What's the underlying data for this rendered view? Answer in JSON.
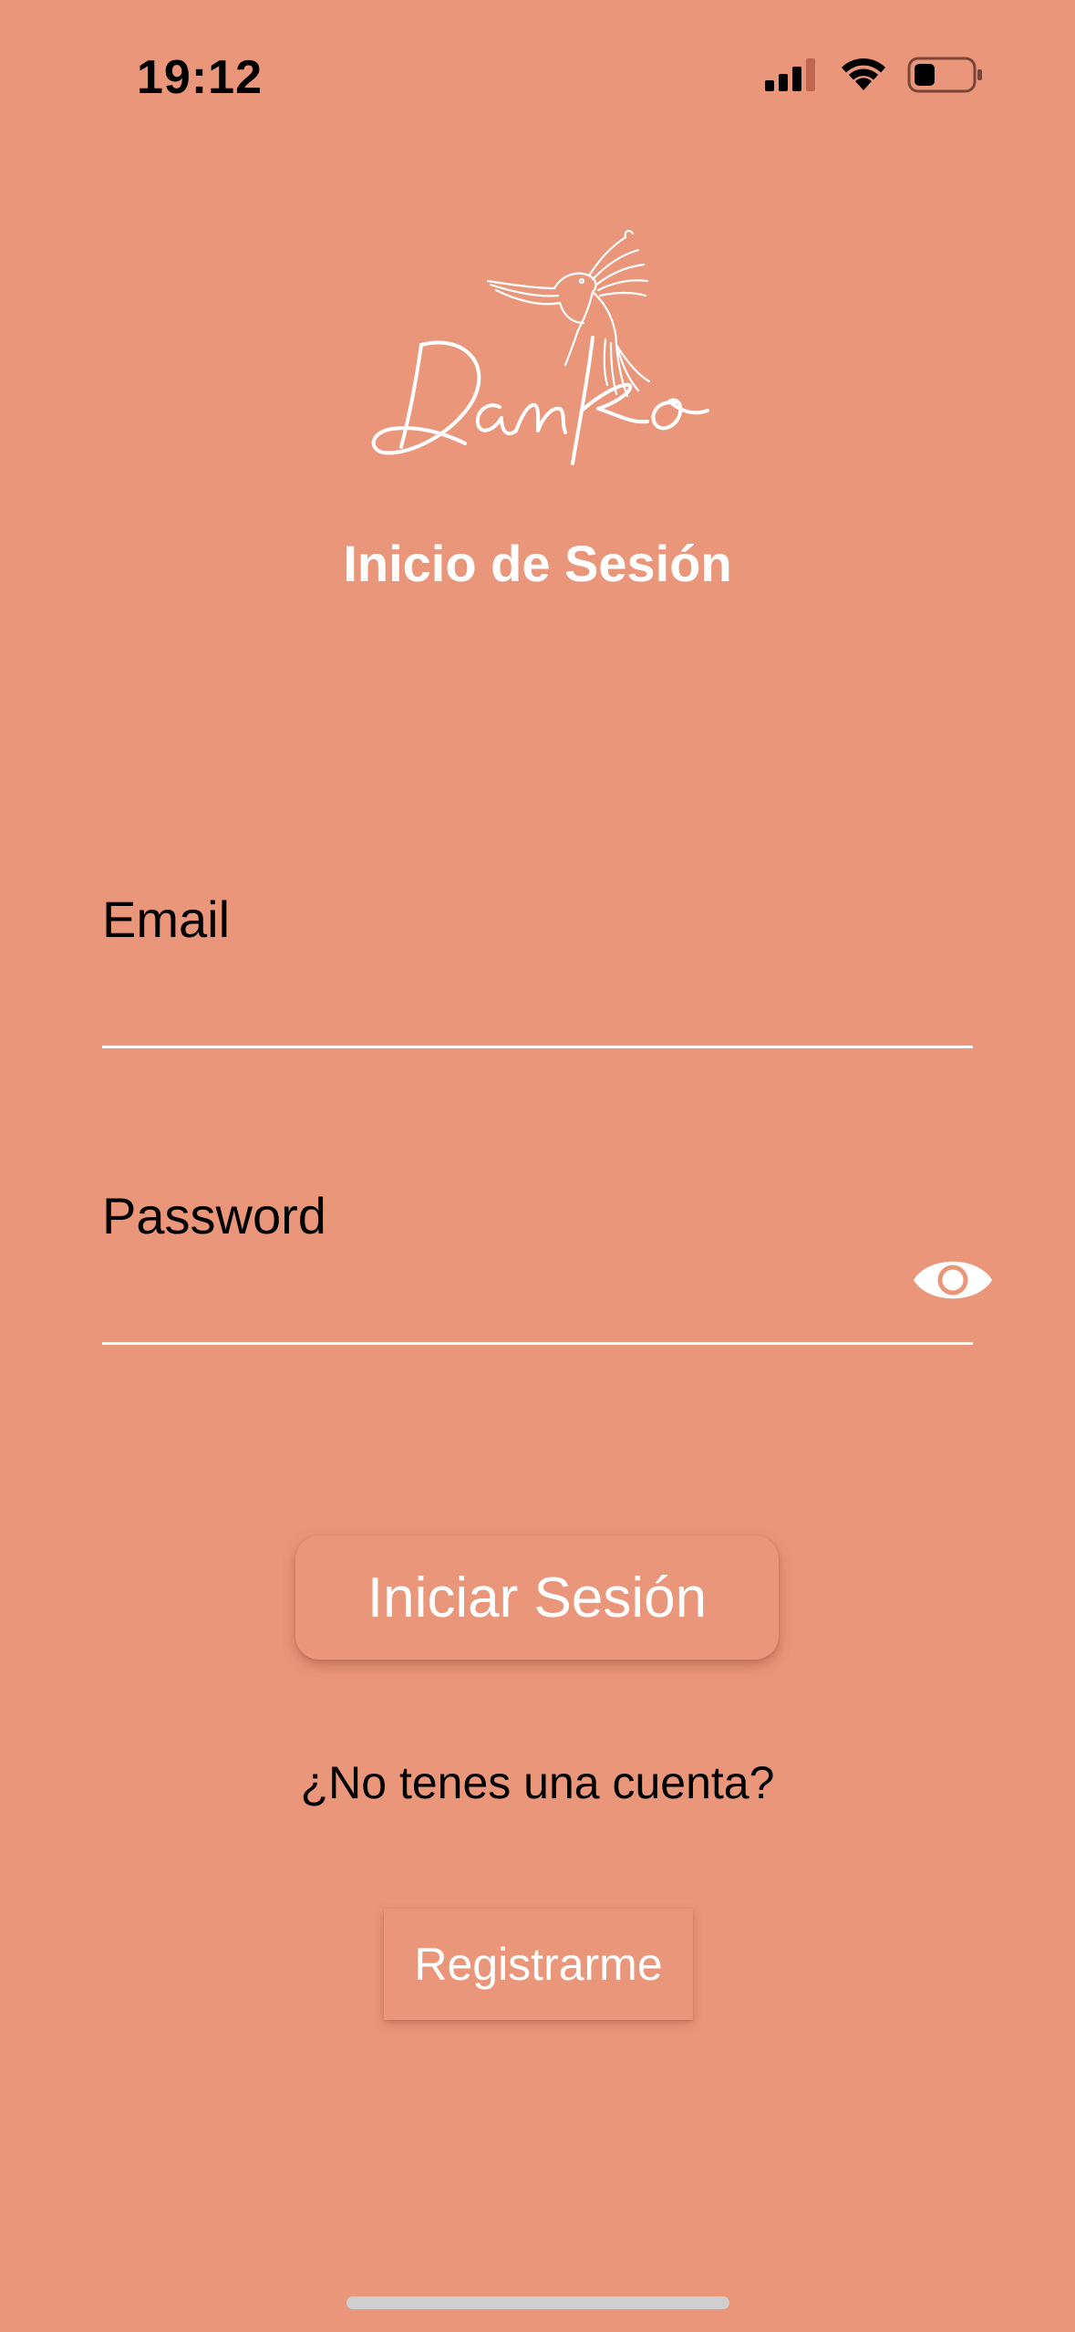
{
  "status_bar": {
    "time": "19:12",
    "icons": [
      "signal-icon",
      "wifi-icon",
      "battery-icon"
    ]
  },
  "logo": {
    "text": "Danko",
    "icon": "hummingbird-icon"
  },
  "page_title": "Inicio de Sesión",
  "form": {
    "email": {
      "label": "Email",
      "value": "",
      "placeholder": ""
    },
    "password": {
      "label": "Password",
      "value": "",
      "placeholder": "",
      "toggle_icon": "eye-icon"
    }
  },
  "login_button_label": "Iniciar Sesión",
  "no_account_text": "¿No tenes una cuenta?",
  "register_button_label": "Registrarme",
  "colors": {
    "background": "#EA967A",
    "text_light": "#FFFFFF",
    "text_dark": "#000000",
    "home_indicator": "#CFCFCF"
  }
}
